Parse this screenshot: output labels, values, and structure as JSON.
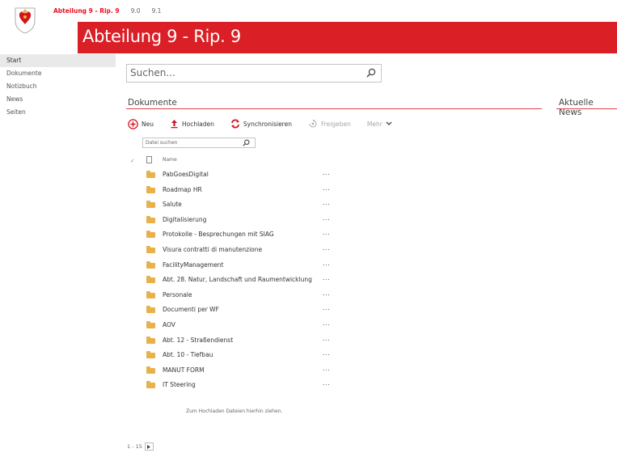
{
  "topnav": {
    "site": "Abteilung 9 - Rip. 9",
    "links": [
      "9.0",
      "9.1"
    ]
  },
  "banner": {
    "title": "Abteilung 9 - Rip. 9"
  },
  "leftnav": {
    "items": [
      "Start",
      "Dokumente",
      "Notizbuch",
      "News",
      "Seiten"
    ],
    "selected": "Start"
  },
  "search": {
    "placeholder": "Suchen..."
  },
  "documents": {
    "title": "Dokumente",
    "toolbar": {
      "new": "Neu",
      "upload": "Hochladen",
      "sync": "Synchronisieren",
      "share": "Freigeben",
      "more": "Mehr"
    },
    "file_search_placeholder": "Datei suchen",
    "column_name": "Name",
    "folders": [
      "PabGoesDigital",
      "Roadmap HR",
      "Salute",
      "Digitalisierung",
      "Protokolle - Besprechungen mit SIAG",
      "Visura contratti di manutenzione",
      "FacilityManagement",
      "Abt. 28. Natur, Landschaft und Raumentwicklung",
      "Personale",
      "Documenti per WF",
      "AOV",
      "Abt. 12 - Straßendienst",
      "Abt. 10 - Tiefbau",
      "MANUT FORM",
      "IT Steering"
    ],
    "row_menu": "...",
    "drop_hint": "Zum Hochladen Dateien hierhin ziehen.",
    "pager": "1 - 15"
  },
  "news": {
    "title": "Aktuelle News"
  },
  "colors": {
    "brand_red": "#da1f26",
    "folder": "#e8b14a",
    "accent_line": "#e03c4a"
  }
}
